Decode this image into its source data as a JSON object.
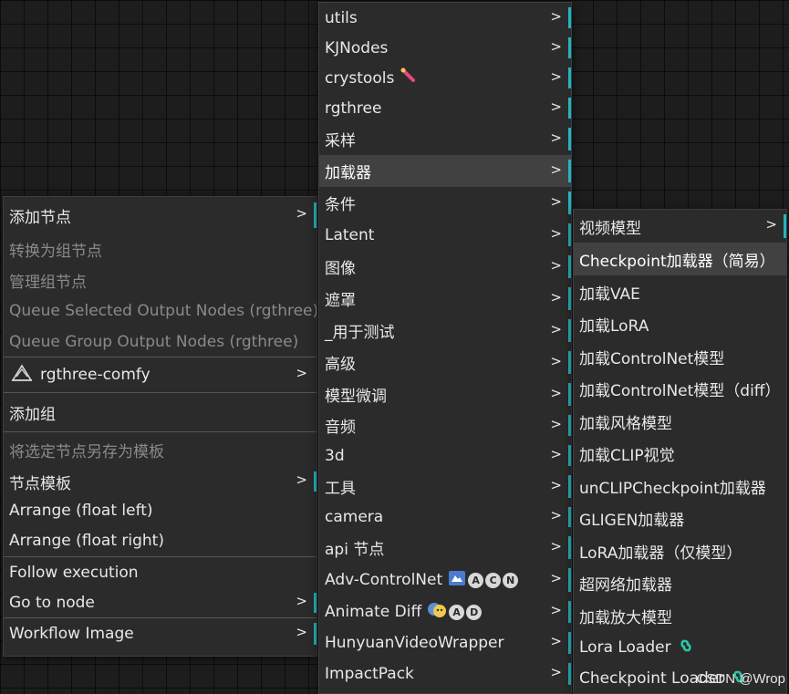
{
  "left_menu": {
    "items": [
      {
        "label": "添加节点"
      },
      {
        "label": "转换为组节点"
      },
      {
        "label": "管理组节点"
      },
      {
        "label": "Queue Selected Output Nodes (rgthree)"
      },
      {
        "label": "Queue Group Output Nodes (rgthree)"
      },
      {
        "label": "rgthree-comfy"
      },
      {
        "label": "添加组"
      },
      {
        "label": "将选定节点另存为模板"
      },
      {
        "label": "节点模板"
      },
      {
        "label": "Arrange (float left)"
      },
      {
        "label": "Arrange (float right)"
      },
      {
        "label": "Follow execution"
      },
      {
        "label": "Go to node"
      },
      {
        "label": "Workflow Image"
      }
    ]
  },
  "middle_menu": {
    "items": [
      {
        "label": "utils"
      },
      {
        "label": "KJNodes"
      },
      {
        "label": "crystools"
      },
      {
        "label": "rgthree"
      },
      {
        "label": "采样"
      },
      {
        "label": "加载器"
      },
      {
        "label": "条件"
      },
      {
        "label": "Latent"
      },
      {
        "label": "图像"
      },
      {
        "label": "遮罩"
      },
      {
        "label": "_用于测试"
      },
      {
        "label": "高级"
      },
      {
        "label": "模型微调"
      },
      {
        "label": "音频"
      },
      {
        "label": "3d"
      },
      {
        "label": "工具"
      },
      {
        "label": "camera"
      },
      {
        "label": "api 节点"
      },
      {
        "label": "Adv-ControlNet",
        "badges": [
          "A",
          "C",
          "N"
        ]
      },
      {
        "label": "Animate Diff",
        "badges": [
          "A",
          "D"
        ]
      },
      {
        "label": "HunyuanVideoWrapper"
      },
      {
        "label": "ImpactPack"
      }
    ]
  },
  "right_menu": {
    "items": [
      {
        "label": "视频模型"
      },
      {
        "label": "Checkpoint加载器（简易）"
      },
      {
        "label": "加载VAE"
      },
      {
        "label": "加载LoRA"
      },
      {
        "label": "加载ControlNet模型"
      },
      {
        "label": "加载ControlNet模型（diff）"
      },
      {
        "label": "加载风格模型"
      },
      {
        "label": "加载CLIP视觉"
      },
      {
        "label": "unCLIPCheckpoint加载器"
      },
      {
        "label": "GLIGEN加载器"
      },
      {
        "label": "LoRA加载器（仅模型）"
      },
      {
        "label": "超网络加载器"
      },
      {
        "label": "加载放大模型"
      },
      {
        "label": "Lora Loader"
      },
      {
        "label": "Checkpoint Loader"
      }
    ]
  },
  "arrow_glyph": ">",
  "watermark": "CSDN @Wrop",
  "colors": {
    "accent": "#22b5c2",
    "menu_bg": "#2b2b2b",
    "highlight": "#414141",
    "disabled_text": "#8a8a8a"
  }
}
